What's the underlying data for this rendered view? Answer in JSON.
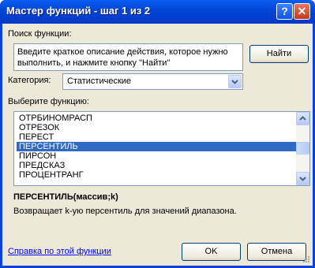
{
  "window": {
    "title": "Мастер функций - шаг 1 из 2",
    "help_glyph": "?",
    "close_glyph": "✕"
  },
  "search": {
    "label": "Поиск функции:",
    "description": "Введите краткое описание действия, которое нужно выполнить, и нажмите кнопку \"Найти\"",
    "find_button": "Найти"
  },
  "category": {
    "label": "Категория:",
    "selected": "Статистические"
  },
  "functions": {
    "label": "Выберите функцию:",
    "items": [
      "ОТРБИНОМРАСП",
      "ОТРЕЗОК",
      "ПЕРЕСТ",
      "ПЕРСЕНТИЛЬ",
      "ПИРСОН",
      "ПРЕДСКАЗ",
      "ПРОЦЕНТРАНГ"
    ],
    "selected": "ПЕРСЕНТИЛЬ"
  },
  "details": {
    "signature": "ПЕРСЕНТИЛЬ(массив;k)",
    "description": "Возвращает k-ую персентиль для значений диапазона."
  },
  "footer": {
    "help_link": "Справка по этой функции",
    "ok_button": "OK",
    "cancel_button": "Отмена"
  }
}
